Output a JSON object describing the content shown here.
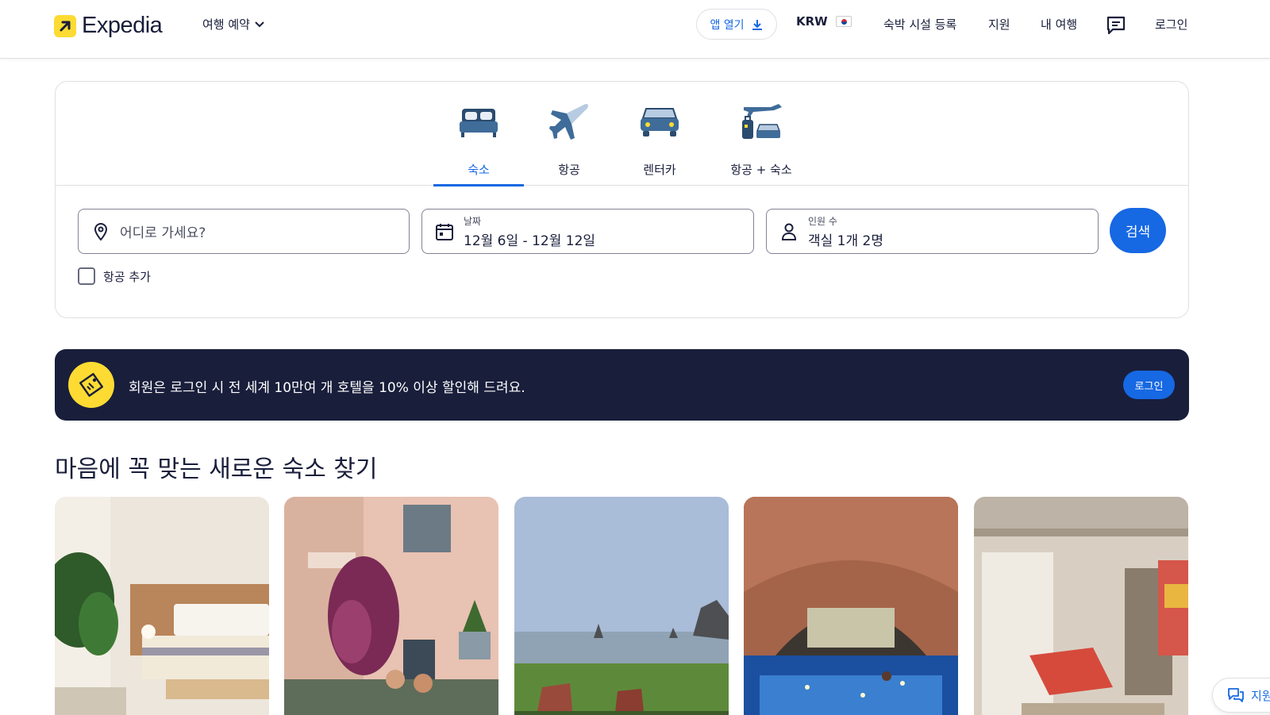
{
  "header": {
    "logo_text": "Expedia",
    "trip_menu_label": "여행 예약",
    "app_button_label": "앱 열기",
    "currency_label": "KRW",
    "list_property_label": "숙박 시설 등록",
    "support_label": "지원",
    "my_trips_label": "내 여행",
    "login_label": "로그인"
  },
  "search": {
    "tabs": [
      {
        "label": "숙소",
        "icon": "bed-icon",
        "active": true
      },
      {
        "label": "항공",
        "icon": "airplane-icon",
        "active": false
      },
      {
        "label": "렌터카",
        "icon": "car-icon",
        "active": false
      },
      {
        "label": "항공 + 숙소",
        "icon": "plane-hotel-icon",
        "active": false
      }
    ],
    "destination_placeholder": "어디로 가세요?",
    "dates_label": "날짜",
    "dates_value": "12월 6일 - 12월 12일",
    "travelers_label": "인원 수",
    "travelers_value": "객실 1개 2명",
    "search_button_label": "검색",
    "add_flight_label": "항공 추가"
  },
  "banner": {
    "text": "회원은 로그인 시 전 세계 10만여 개 호텔을 10% 이상 할인해 드려요.",
    "button_label": "로그인"
  },
  "section": {
    "title": "마음에 꼭 맞는 새로운 숙소 찾기"
  },
  "help_bubble_label": "지원",
  "colors": {
    "brand_blue": "#1668e3",
    "brand_yellow": "#fddb32",
    "navy": "#191e3b"
  }
}
